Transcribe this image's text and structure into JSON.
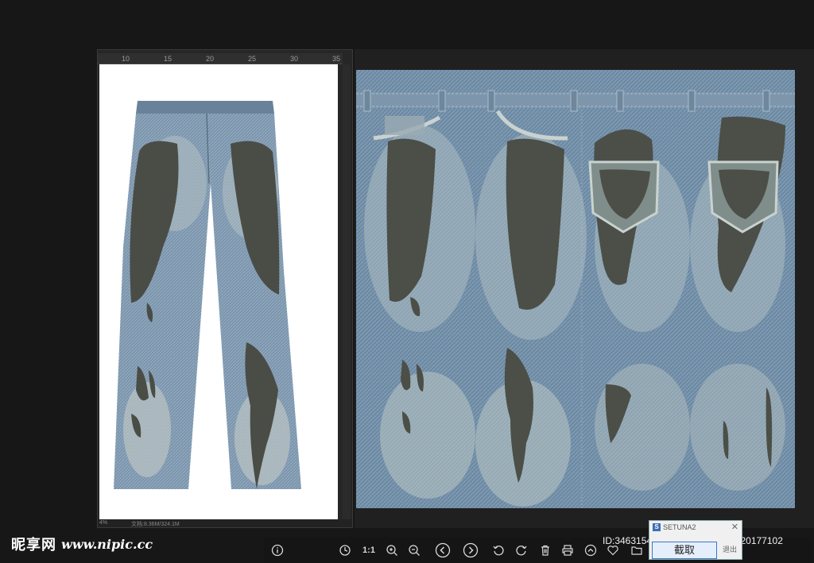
{
  "editor": {
    "ruler_ticks": [
      "10",
      "15",
      "20",
      "25",
      "30",
      "35"
    ],
    "zoom": "4%",
    "doc_info": "文档:8.36M/324.1M"
  },
  "toolbar": {
    "info": "info-icon",
    "one_to_one_label": "1:1"
  },
  "watermark": {
    "brand_cn": "昵享网",
    "url": "www.nipic.cc"
  },
  "id_line": "ID:34631543 NO:20241209191520177102",
  "setuna": {
    "title": "SETUNA2",
    "ok_label": "截取",
    "cancel_label": "退出"
  }
}
